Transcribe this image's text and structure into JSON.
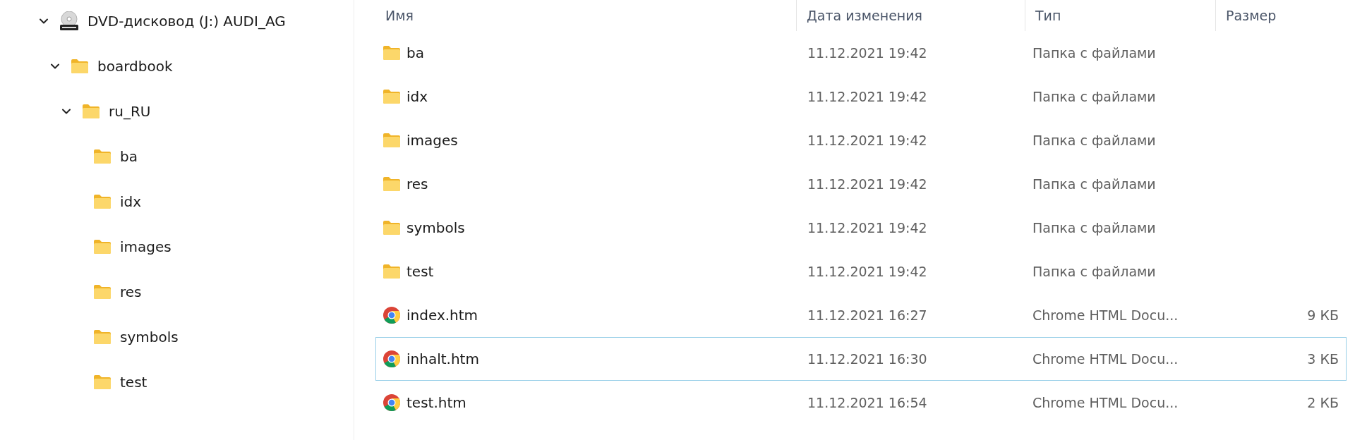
{
  "navigation_tree": [
    {
      "label": "DVD-дисковод (J:) AUDI_AG",
      "kind": "dvd",
      "expanded": true,
      "children": [
        {
          "label": "boardbook",
          "kind": "folder",
          "expanded": true,
          "children": [
            {
              "label": "ru_RU",
              "kind": "folder",
              "expanded": true,
              "children": [
                {
                  "label": "ba",
                  "kind": "folder",
                  "expanded": false
                },
                {
                  "label": "idx",
                  "kind": "folder",
                  "expanded": false
                },
                {
                  "label": "images",
                  "kind": "folder",
                  "expanded": false
                },
                {
                  "label": "res",
                  "kind": "folder",
                  "expanded": false
                },
                {
                  "label": "symbols",
                  "kind": "folder",
                  "expanded": false
                },
                {
                  "label": "test",
                  "kind": "folder",
                  "expanded": false
                }
              ]
            }
          ]
        }
      ]
    }
  ],
  "file_list": {
    "columns": [
      "Имя",
      "Дата изменения",
      "Тип",
      "Размер"
    ],
    "rows": [
      {
        "name": "ba",
        "kind": "folder",
        "modified": "11.12.2021 19:42",
        "type": "Папка с файлами",
        "focused": false
      },
      {
        "name": "idx",
        "kind": "folder",
        "modified": "11.12.2021 19:42",
        "type": "Папка с файлами",
        "focused": false
      },
      {
        "name": "images",
        "kind": "folder",
        "modified": "11.12.2021 19:42",
        "type": "Папка с файлами",
        "focused": false
      },
      {
        "name": "res",
        "kind": "folder",
        "modified": "11.12.2021 19:42",
        "type": "Папка с файлами",
        "focused": false
      },
      {
        "name": "symbols",
        "kind": "folder",
        "modified": "11.12.2021 19:42",
        "type": "Папка с файлами",
        "focused": false
      },
      {
        "name": "test",
        "kind": "folder",
        "modified": "11.12.2021 19:42",
        "type": "Папка с файлами",
        "focused": false
      },
      {
        "name": "index.htm",
        "kind": "html",
        "modified": "11.12.2021 16:27",
        "type": "Chrome HTML Docu...",
        "size": "9 КБ",
        "focused": false
      },
      {
        "name": "inhalt.htm",
        "kind": "html",
        "modified": "11.12.2021 16:30",
        "type": "Chrome HTML Docu...",
        "size": "3 КБ",
        "focused": true
      },
      {
        "name": "test.htm",
        "kind": "html",
        "modified": "11.12.2021 16:54",
        "type": "Chrome HTML Docu...",
        "size": "2 КБ",
        "focused": false
      }
    ]
  }
}
